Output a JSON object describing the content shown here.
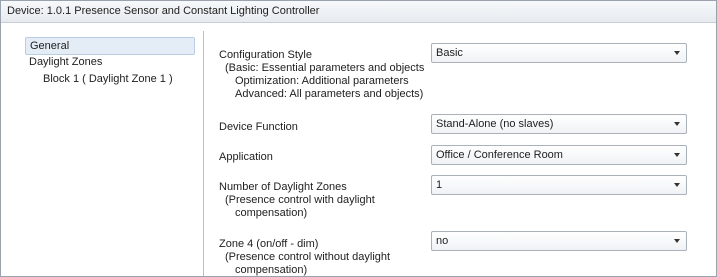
{
  "window": {
    "title": "Device: 1.0.1  Presence Sensor and Constant Lighting Controller"
  },
  "sidebar": {
    "items": [
      {
        "label": "General",
        "selected": true
      },
      {
        "label": "Daylight Zones",
        "selected": false
      },
      {
        "label": "Block 1 ( Daylight Zone 1 )",
        "selected": false
      }
    ]
  },
  "params": {
    "config_style": {
      "label": "Configuration Style",
      "hint1": "(Basic: Essential parameters and objects",
      "hint2": "Optimization: Additional parameters",
      "hint3": "Advanced: All parameters and objects)",
      "value": "Basic"
    },
    "device_function": {
      "label": "Device Function",
      "value": "Stand-Alone (no slaves)"
    },
    "application": {
      "label": "Application",
      "value": "Office / Conference Room"
    },
    "num_zones": {
      "label": "Number of Daylight Zones",
      "hint1": "(Presence control with daylight",
      "hint2": "compensation)",
      "value": "1"
    },
    "zone4": {
      "label": "Zone 4 (on/off - dim)",
      "hint1": "(Presence control without daylight",
      "hint2": "compensation)",
      "value": "no"
    }
  },
  "icons": {
    "dropdown_arrow": "chevron-down-icon"
  }
}
